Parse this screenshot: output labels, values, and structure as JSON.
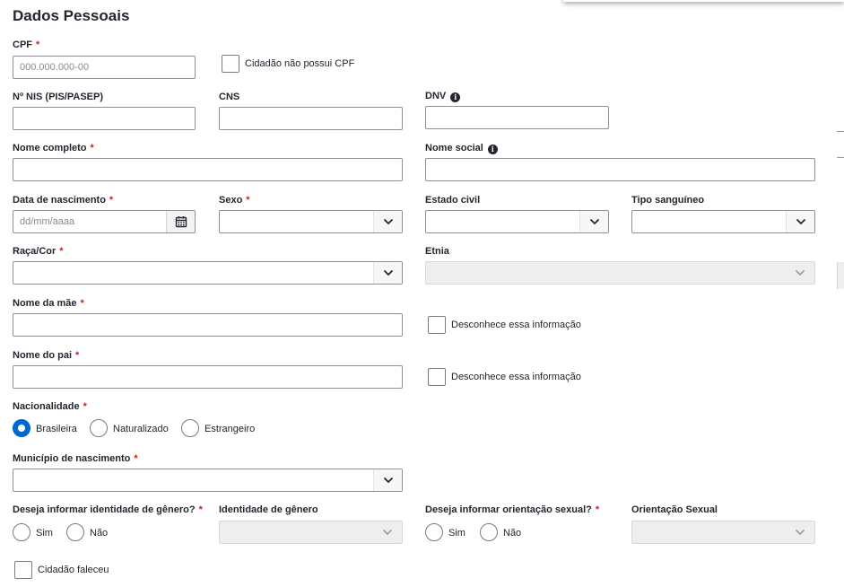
{
  "section": {
    "title": "Dados Pessoais"
  },
  "fields": {
    "cpf": {
      "label": "CPF",
      "placeholder": "000.000.000-00",
      "value": ""
    },
    "no_cpf": {
      "label": "Cidadão não possui CPF",
      "checked": false
    },
    "nis": {
      "label": "Nº NIS (PIS/PASEP)",
      "value": ""
    },
    "cns": {
      "label": "CNS",
      "value": ""
    },
    "dnv": {
      "label": "DNV",
      "value": ""
    },
    "nome_completo": {
      "label": "Nome completo",
      "value": ""
    },
    "nome_social": {
      "label": "Nome social",
      "value": ""
    },
    "data_nascimento": {
      "label": "Data de nascimento",
      "placeholder": "dd/mm/aaaa"
    },
    "sexo": {
      "label": "Sexo",
      "value": ""
    },
    "estado_civil": {
      "label": "Estado civil",
      "value": ""
    },
    "tipo_sanguineo": {
      "label": "Tipo sanguíneo",
      "value": ""
    },
    "raca_cor": {
      "label": "Raça/Cor",
      "value": ""
    },
    "etnia": {
      "label": "Etnia",
      "value": "",
      "disabled": true
    },
    "nome_mae": {
      "label": "Nome da mãe",
      "value": ""
    },
    "mae_desconhece": {
      "label": "Desconhece essa informação",
      "checked": false
    },
    "nome_pai": {
      "label": "Nome do pai",
      "value": ""
    },
    "pai_desconhece": {
      "label": "Desconhece essa informação",
      "checked": false
    },
    "nacionalidade": {
      "label": "Nacionalidade",
      "options": [
        "Brasileira",
        "Naturalizado",
        "Estrangeiro"
      ],
      "selected": "Brasileira"
    },
    "municipio_nascimento": {
      "label": "Município de nascimento",
      "value": ""
    },
    "deseja_identidade_genero": {
      "label": "Deseja informar identidade de gênero?",
      "options": [
        "Sim",
        "Não"
      ]
    },
    "identidade_genero": {
      "label": "Identidade de gênero",
      "disabled": true
    },
    "deseja_orientacao_sexual": {
      "label": "Deseja informar orientação sexual?",
      "options": [
        "Sim",
        "Não"
      ]
    },
    "orientacao_sexual": {
      "label": "Orientação Sexual",
      "disabled": true
    },
    "cidadao_faleceu": {
      "label": "Cidadão faleceu",
      "checked": false
    }
  },
  "required_marker": "*",
  "icons": {
    "info": "info-icon",
    "calendar": "calendar-icon",
    "chevron": "chevron-down-icon"
  },
  "colors": {
    "accent": "#0069d0",
    "required": "#d01e1e",
    "text": "#24252e"
  }
}
